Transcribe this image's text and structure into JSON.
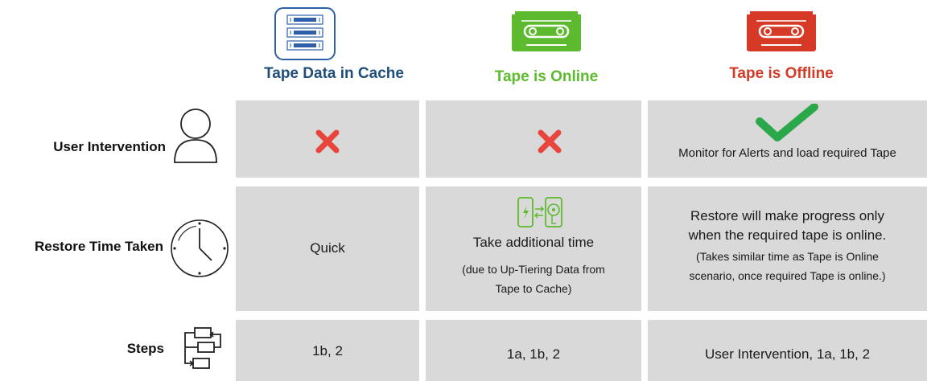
{
  "columns": [
    {
      "label": "Tape Data in Cache",
      "color": "#1f4e79",
      "icon": "server-cache-icon"
    },
    {
      "label": "Tape is Online",
      "color": "#5dba2e",
      "icon": "tape-cassette-online-icon"
    },
    {
      "label": "Tape is Offline",
      "color": "#d63a26",
      "icon": "tape-cassette-offline-icon"
    }
  ],
  "rows": [
    {
      "label": "User Intervention",
      "icon": "user-icon",
      "cells": [
        {
          "icon": "red-x-icon"
        },
        {
          "icon": "red-x-icon"
        },
        {
          "icon": "green-check-icon",
          "text": "Monitor for Alerts and load required Tape"
        }
      ]
    },
    {
      "label": "Restore Time Taken",
      "icon": "clock-icon",
      "cells": [
        {
          "text": "Quick"
        },
        {
          "icon": "up-tiering-icon",
          "text": "Take additional time",
          "subtext_line1": "(due to Up-Tiering Data from",
          "subtext_line2": "Tape to Cache)"
        },
        {
          "line1": "Restore will make progress only",
          "line2": "when the required tape is online.",
          "line3": "(Takes similar time as Tape is Online",
          "line4": "scenario, once required Tape is online.)"
        }
      ]
    },
    {
      "label": "Steps",
      "icon": "steps-flow-icon",
      "cells": [
        {
          "text": "1b, 2"
        },
        {
          "text": "1a, 1b, 2"
        },
        {
          "text": "User Intervention, 1a, 1b, 2"
        }
      ]
    }
  ]
}
